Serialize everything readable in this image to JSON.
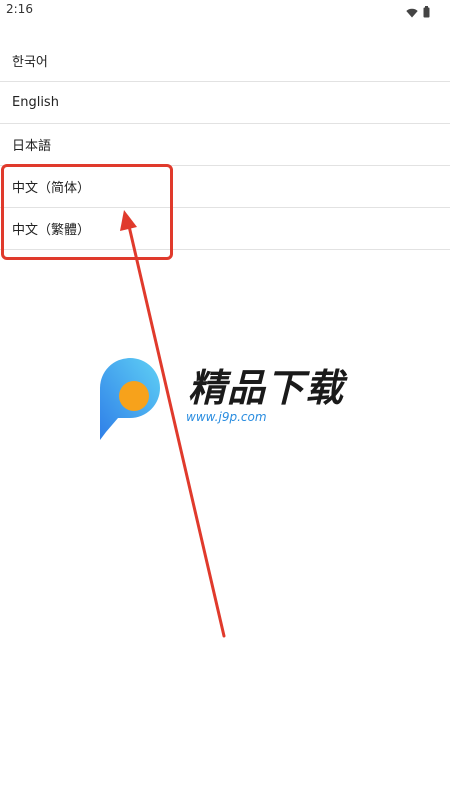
{
  "status_bar": {
    "time": "2:16",
    "icons": [
      "wifi-icon",
      "battery-icon"
    ]
  },
  "language_list": {
    "items": [
      {
        "label": "한국어"
      },
      {
        "label": "English"
      },
      {
        "label": "日本語"
      },
      {
        "label": "中文（简体）"
      },
      {
        "label": "中文（繁體）"
      }
    ]
  },
  "annotation": {
    "color": "#e03a2c"
  },
  "watermark": {
    "title": "精品下载",
    "url": "www.j9p.com",
    "logo_colors": [
      "#3aa0f0",
      "#f7a21b"
    ]
  }
}
